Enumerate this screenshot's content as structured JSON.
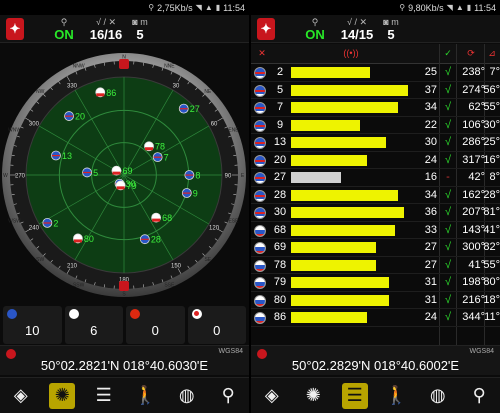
{
  "left": {
    "status": {
      "speed": "2,75Kb/s",
      "time": "11:54"
    },
    "top": {
      "fix": "ON",
      "sats": "16/16",
      "meters": "5"
    },
    "compass": {
      "ticks": [
        "30",
        "60",
        "90",
        "120",
        "150",
        "180",
        "210",
        "240",
        "270",
        "300",
        "330"
      ],
      "cardinals": [
        "N",
        "NNE",
        "NE",
        "ENE",
        "E",
        "ESE",
        "SE",
        "SSE",
        "S",
        "SSW",
        "SW",
        "WSW",
        "W",
        "WNW",
        "NW",
        "NNW"
      ]
    },
    "satellites": [
      {
        "prn": "2",
        "az": 238,
        "el": 7,
        "flag": "us"
      },
      {
        "prn": "5",
        "az": 274,
        "el": 56,
        "flag": "us"
      },
      {
        "prn": "7",
        "az": 62,
        "el": 55,
        "flag": "us"
      },
      {
        "prn": "9",
        "az": 106,
        "el": 30,
        "flag": "us"
      },
      {
        "prn": "13",
        "az": 286,
        "el": 25,
        "flag": "us"
      },
      {
        "prn": "20",
        "az": 317,
        "el": 16,
        "flag": "us"
      },
      {
        "prn": "27",
        "az": 42,
        "el": 8,
        "flag": "us"
      },
      {
        "prn": "28",
        "az": 162,
        "el": 28,
        "flag": "us"
      },
      {
        "prn": "30",
        "az": 207,
        "el": 81,
        "flag": "us"
      },
      {
        "prn": "68",
        "az": 143,
        "el": 41,
        "flag": "ru"
      },
      {
        "prn": "69",
        "az": 300,
        "el": 82,
        "flag": "ru"
      },
      {
        "prn": "78",
        "az": 41,
        "el": 55,
        "flag": "ru"
      },
      {
        "prn": "79",
        "az": 198,
        "el": 80,
        "flag": "ru"
      },
      {
        "prn": "80",
        "az": 216,
        "el": 18,
        "flag": "ru"
      },
      {
        "prn": "86",
        "az": 344,
        "el": 11,
        "flag": "ru"
      },
      {
        "prn": "8",
        "az": 90,
        "el": 30,
        "flag": "us"
      }
    ],
    "counts": [
      {
        "flag": "us",
        "value": "10"
      },
      {
        "flag": "ru",
        "value": "6"
      },
      {
        "flag": "cn",
        "value": "0"
      },
      {
        "flag": "jp",
        "value": "0"
      }
    ],
    "coords": {
      "datum": "WGS84",
      "text": "50°02.2821'N  018°40.6030'E"
    }
  },
  "right": {
    "status": {
      "speed": "9,80Kb/s",
      "time": "11:54"
    },
    "top": {
      "fix": "ON",
      "sats": "14/15",
      "meters": "5"
    },
    "headers": {
      "snr": "((•))",
      "used": "✓",
      "az": "⟳",
      "el": "⊿"
    },
    "rows": [
      {
        "flag": "us",
        "prn": "2",
        "snr": "25",
        "snr_val": 25,
        "used": "√",
        "az": "238°",
        "el": "7°"
      },
      {
        "flag": "us",
        "prn": "5",
        "snr": "37",
        "snr_val": 37,
        "used": "√",
        "az": "274°",
        "el": "56°"
      },
      {
        "flag": "us",
        "prn": "7",
        "snr": "34",
        "snr_val": 34,
        "used": "√",
        "az": "62°",
        "el": "55°"
      },
      {
        "flag": "us",
        "prn": "9",
        "snr": "22",
        "snr_val": 22,
        "used": "√",
        "az": "106°",
        "el": "30°"
      },
      {
        "flag": "us",
        "prn": "13",
        "snr": "30",
        "snr_val": 30,
        "used": "√",
        "az": "286°",
        "el": "25°"
      },
      {
        "flag": "us",
        "prn": "20",
        "snr": "24",
        "snr_val": 24,
        "used": "√",
        "az": "317°",
        "el": "16°"
      },
      {
        "flag": "us",
        "prn": "27",
        "snr": "16",
        "snr_val": 16,
        "used": "-",
        "az": "42°",
        "el": "8°",
        "gray": true
      },
      {
        "flag": "us",
        "prn": "28",
        "snr": "34",
        "snr_val": 34,
        "used": "√",
        "az": "162°",
        "el": "28°"
      },
      {
        "flag": "us",
        "prn": "30",
        "snr": "36",
        "snr_val": 36,
        "used": "√",
        "az": "207°",
        "el": "81°"
      },
      {
        "flag": "ru",
        "prn": "68",
        "snr": "33",
        "snr_val": 33,
        "used": "√",
        "az": "143°",
        "el": "41°"
      },
      {
        "flag": "ru",
        "prn": "69",
        "snr": "27",
        "snr_val": 27,
        "used": "√",
        "az": "300°",
        "el": "82°"
      },
      {
        "flag": "ru",
        "prn": "78",
        "snr": "27",
        "snr_val": 27,
        "used": "√",
        "az": "41°",
        "el": "55°"
      },
      {
        "flag": "ru",
        "prn": "79",
        "snr": "31",
        "snr_val": 31,
        "used": "√",
        "az": "198°",
        "el": "80°"
      },
      {
        "flag": "ru",
        "prn": "80",
        "snr": "31",
        "snr_val": 31,
        "used": "√",
        "az": "216°",
        "el": "18°"
      },
      {
        "flag": "ru",
        "prn": "86",
        "snr": "24",
        "snr_val": 24,
        "used": "√",
        "az": "344°",
        "el": "11°"
      }
    ],
    "coords": {
      "datum": "WGS84",
      "text": "50°02.2829'N  018°40.6002'E"
    }
  },
  "nav": {
    "icons": [
      "compass-icon",
      "radar-icon",
      "signal-bars-icon",
      "walk-icon",
      "globe-icon",
      "map-pin-icon"
    ]
  },
  "colors": {
    "accent": "#c8161d",
    "bar": "#eef300",
    "fix": "#28e828",
    "radar": "#0d3d14"
  }
}
